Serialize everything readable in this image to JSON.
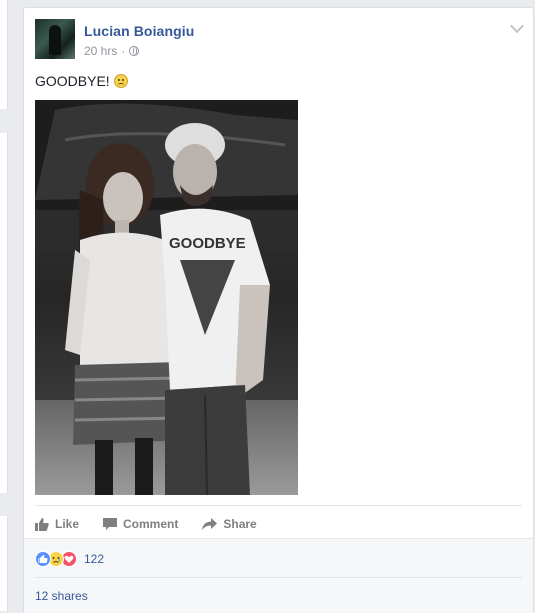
{
  "post": {
    "author": "Lucian Boiangiu",
    "timestamp": "20 hrs",
    "separator": "·",
    "text": "GOODBYE!",
    "photo_shirt_text": "GOODBYE"
  },
  "actions": {
    "like": "Like",
    "comment": "Comment",
    "share": "Share"
  },
  "reactions": {
    "count": "122",
    "types": [
      "like",
      "sad",
      "love"
    ]
  },
  "shares": "12 shares",
  "colors": {
    "link": "#365899",
    "meta": "#90949c",
    "action": "#7f7f7f",
    "background": "#e9ebee"
  }
}
